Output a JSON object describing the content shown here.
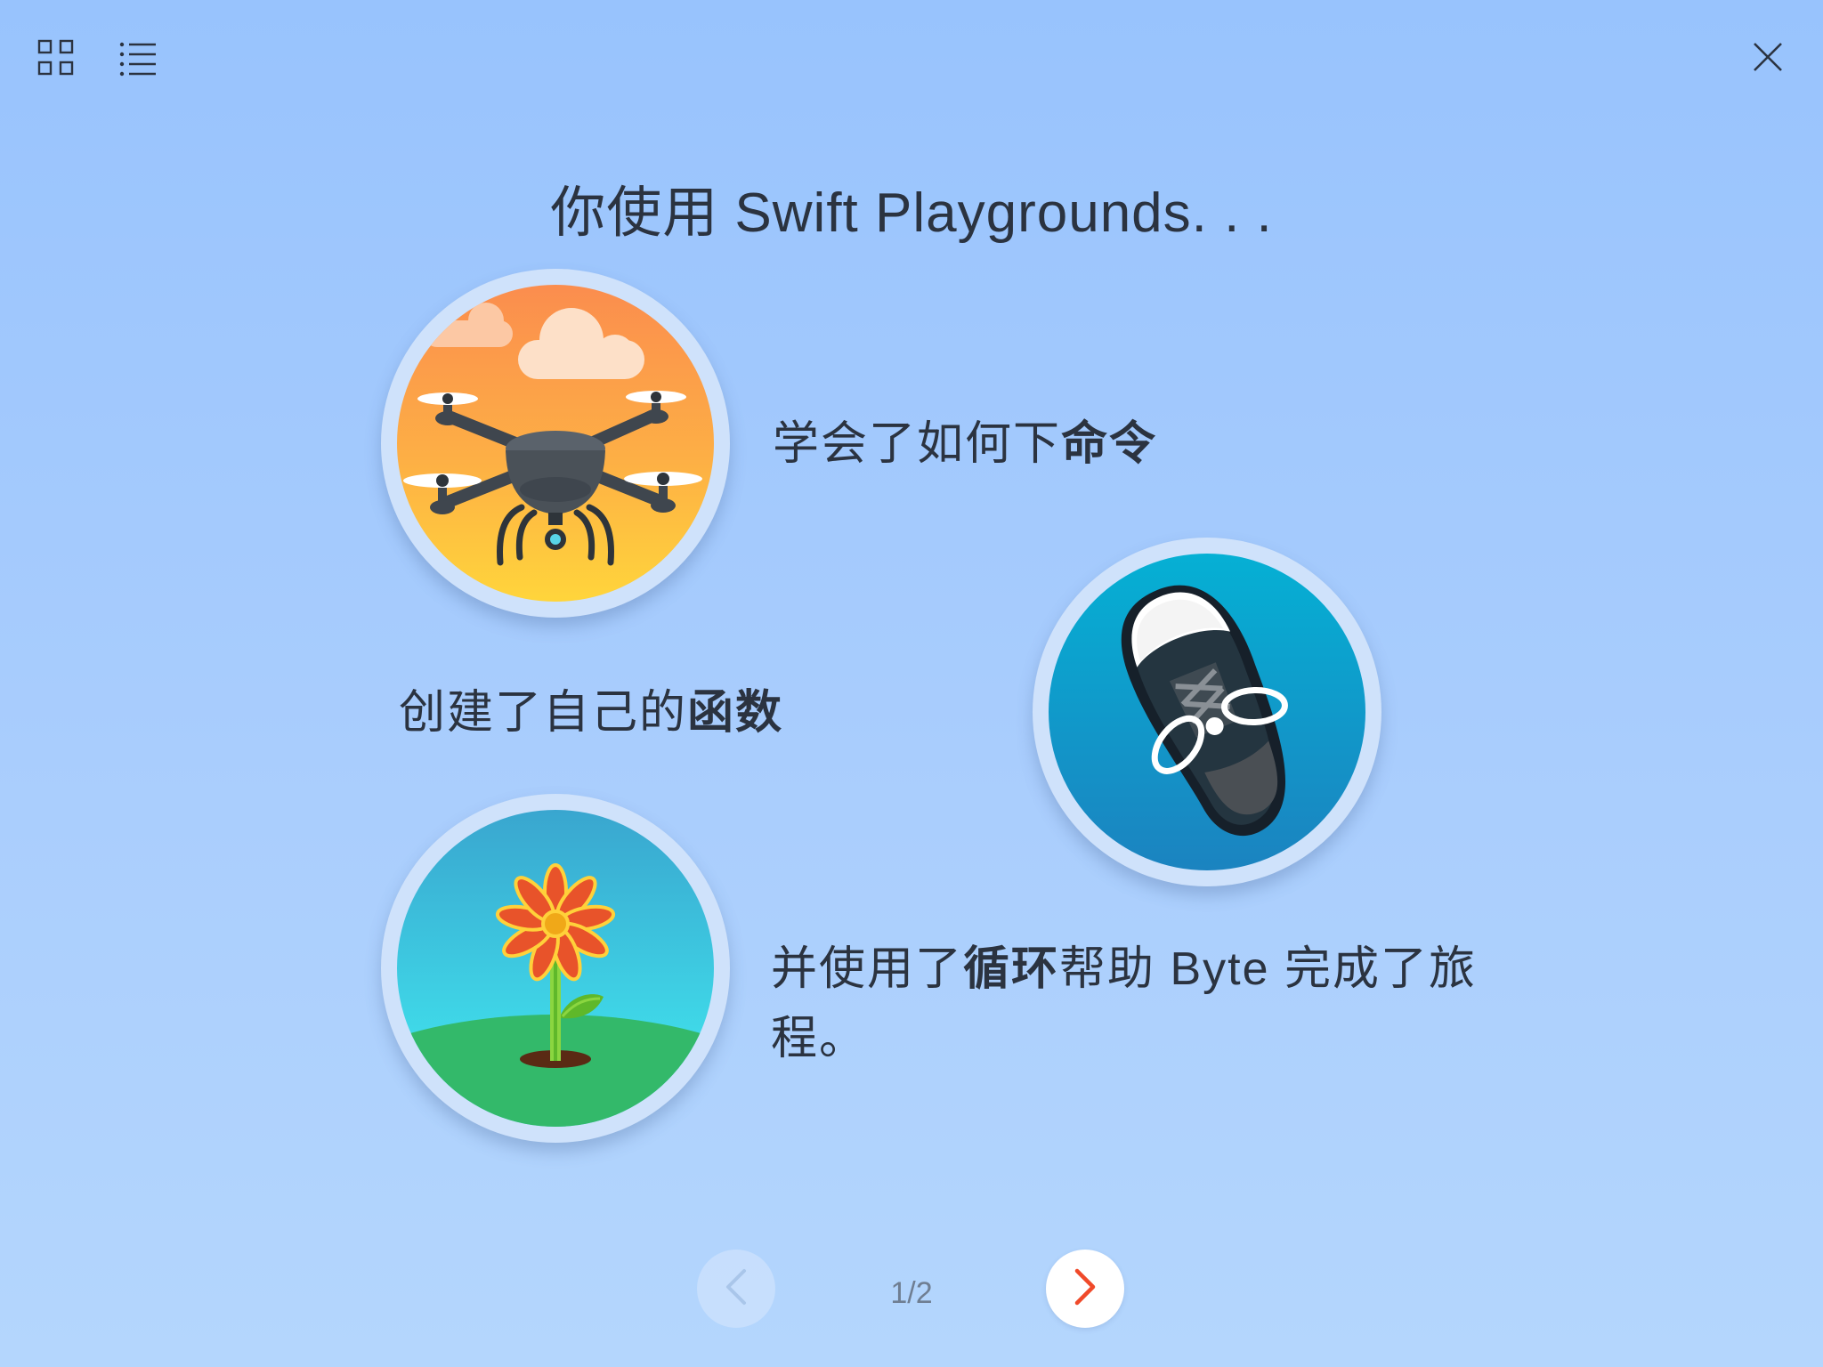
{
  "toolbar": {
    "grid_icon": "grid-icon",
    "list_icon": "list-icon",
    "close_icon": "close-icon"
  },
  "title": "你使用 Swift Playgrounds. . .",
  "items": [
    {
      "icon": "drone-illustration",
      "text_normal": "学会了如何下",
      "text_bold": "命令",
      "text_after": ""
    },
    {
      "icon": "shoe-illustration",
      "text_normal": "创建了自己的",
      "text_bold": "函数",
      "text_after": ""
    },
    {
      "icon": "flower-illustration",
      "text_normal": "并使用了",
      "text_bold": "循环",
      "text_after": "帮助 Byte 完成了旅程。"
    }
  ],
  "pager": {
    "label": "1/2",
    "prev_icon": "chevron-left-icon",
    "next_icon": "chevron-right-icon"
  },
  "colors": {
    "accent": "#f04a2a",
    "background_top": "#98c3fd",
    "background_bottom": "#b4d6fd",
    "text": "#2b3340"
  }
}
